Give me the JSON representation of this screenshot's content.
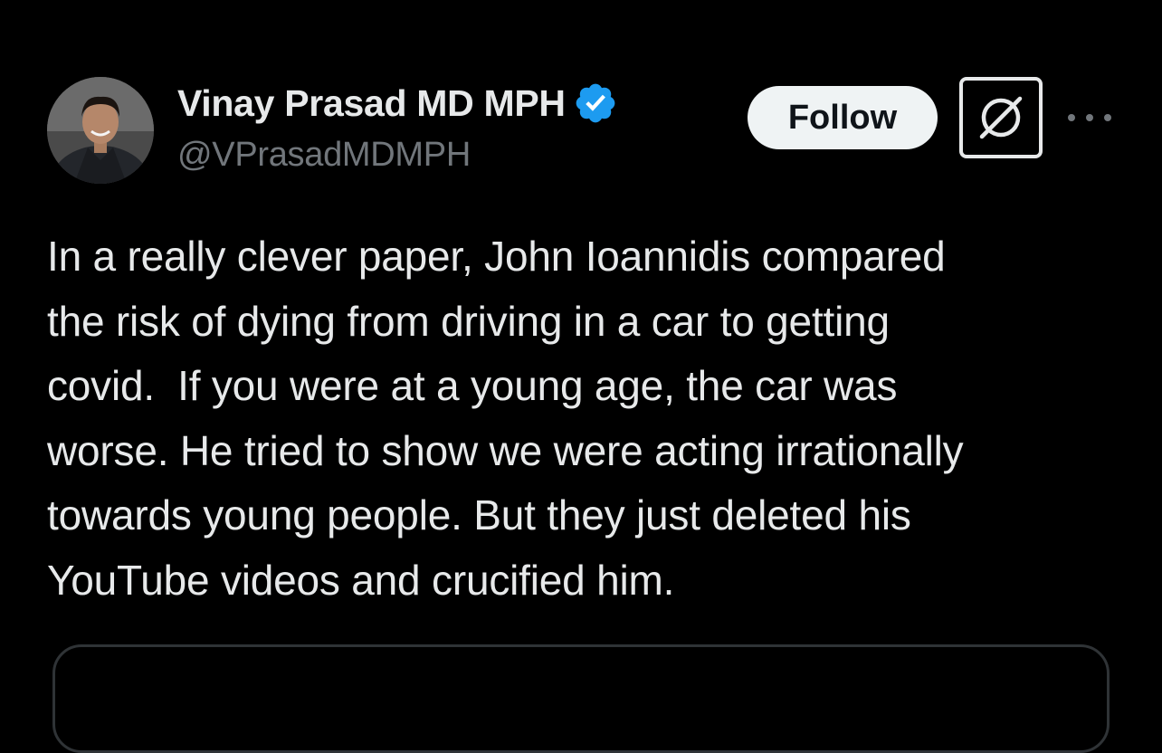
{
  "tweet": {
    "author": {
      "display_name": "Vinay Prasad MD MPH",
      "handle": "@VPrasadMDMPH",
      "verified_icon": "verified-badge-icon",
      "avatar": "profile-photo"
    },
    "actions": {
      "follow_label": "Follow",
      "grok_icon": "grok-icon",
      "more_icon": "more-options-icon"
    },
    "text_lines": [
      "In a really clever paper, John Ioannidis compared",
      "the risk of dying from driving in a car to getting",
      "covid.  If you were at a young age, the car was",
      "worse. He tried to show we were acting irrationally",
      "towards young people. But they just deleted his",
      "YouTube videos and crucified him."
    ]
  },
  "colors": {
    "background": "#000000",
    "text_primary": "#e7e9ea",
    "text_secondary": "#71767b",
    "verified_blue": "#1d9bf0",
    "follow_bg": "#eff3f4",
    "border": "#2f3336"
  }
}
